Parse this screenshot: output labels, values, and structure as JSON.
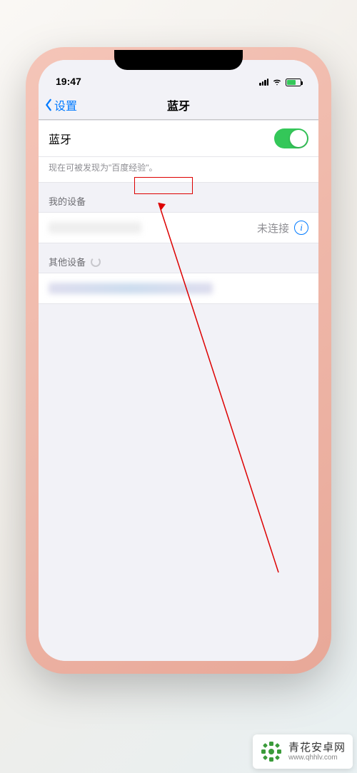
{
  "status": {
    "time": "19:47"
  },
  "nav": {
    "back_label": "设置",
    "title": "蓝牙"
  },
  "bluetooth": {
    "label": "蓝牙",
    "enabled": true,
    "discoverable_hint": "现在可被发现为\"百度经验\"。"
  },
  "sections": {
    "my_devices_header": "我的设备",
    "other_devices_header": "其他设备"
  },
  "my_device": {
    "status": "未连接"
  },
  "watermark": {
    "title": "青花安卓网",
    "url": "www.qhhlv.com"
  }
}
